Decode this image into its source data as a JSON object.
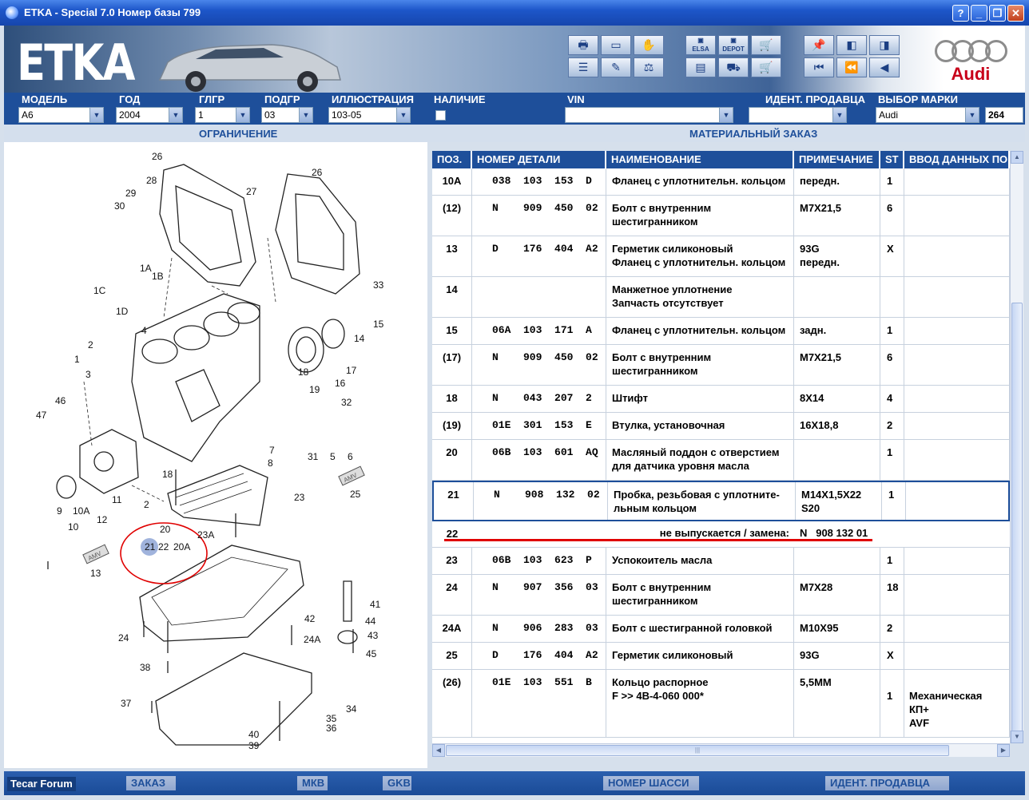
{
  "window": {
    "title": "ETKA - Special 7.0 Номер базы 799"
  },
  "banner": {
    "logo": "ETKA",
    "brand": "Audi"
  },
  "fields": {
    "model_label": "МОДЕЛЬ",
    "model_value": "A6",
    "year_label": "ГОД",
    "year_value": "2004",
    "mgroup_label": "ГЛГР",
    "mgroup_value": "1",
    "sgroup_label": "ПОДГР",
    "sgroup_value": "03",
    "illus_label": "ИЛЛЮСТРАЦИЯ",
    "illus_value": "103-05",
    "avail_label": "НАЛИЧИЕ",
    "vin_label": "VIN",
    "dealer_label": "ИДЕНТ. ПРОДАВЦА",
    "brand_label": "ВЫБОР МАРКИ",
    "brand_value": "Audi",
    "brand_code": "264"
  },
  "strip": {
    "left": "ОГРАНИЧЕНИЕ",
    "right": "МАТЕРИАЛЬНЫЙ ЗАКАЗ"
  },
  "table": {
    "headers": [
      "ПОЗ.",
      "НОМЕР ДЕТАЛИ",
      "НАИМЕНОВАНИЕ",
      "ПРИМЕЧАНИЕ",
      "ST",
      "ВВОД ДАННЫХ ПО"
    ],
    "rows": [
      {
        "pos": "10A",
        "part": "038  103  153  D",
        "name": [
          "Фланец с уплотнительн. кольцом"
        ],
        "note": [
          "передн."
        ],
        "st": "1",
        "inp": []
      },
      {
        "pos": "(12)",
        "part": "N    909  450  02",
        "name": [
          "Болт с внутренним",
          "шестигранником"
        ],
        "note": [
          "M7X21,5"
        ],
        "st": "6",
        "inp": []
      },
      {
        "pos": "13",
        "part": "D    176  404  A2",
        "name": [
          "Герметик силиконовый",
          "Фланец с уплотнительн. кольцом"
        ],
        "note": [
          "93G",
          "передн."
        ],
        "st": "X",
        "inp": []
      },
      {
        "pos": "14",
        "part": "",
        "name": [
          "Манжетное уплотнение",
          "Запчасть отсутствует"
        ],
        "note": [],
        "st": "",
        "inp": []
      },
      {
        "pos": "15",
        "part": "06A  103  171  A",
        "name": [
          "Фланец с уплотнительн. кольцом"
        ],
        "note": [
          "задн."
        ],
        "st": "1",
        "inp": []
      },
      {
        "pos": "(17)",
        "part": "N    909  450  02",
        "name": [
          "Болт с внутренним",
          "шестигранником"
        ],
        "note": [
          "M7X21,5"
        ],
        "st": "6",
        "inp": []
      },
      {
        "pos": "18",
        "part": "N    043  207  2",
        "name": [
          "Штифт"
        ],
        "note": [
          "8X14"
        ],
        "st": "4",
        "inp": []
      },
      {
        "pos": "(19)",
        "part": "01E  301  153  E",
        "name": [
          "Втулка, установочная"
        ],
        "note": [
          "16X18,8"
        ],
        "st": "2",
        "inp": []
      },
      {
        "pos": "20",
        "part": "06B  103  601  AQ",
        "name": [
          "Масляный поддон с отверстием",
          "для датчика уровня масла"
        ],
        "note": [],
        "st": "1",
        "inp": []
      },
      {
        "pos": "21",
        "part": "N    908  132  02",
        "name": [
          "Пробка, резьбовая с уплотните-",
          "льным кольцом"
        ],
        "note": [
          "M14X1,5X22",
          "S20"
        ],
        "st": "1",
        "inp": []
      },
      {
        "pos": "23",
        "part": "06B  103  623  P",
        "name": [
          "Успокоитель масла"
        ],
        "note": [],
        "st": "1",
        "inp": []
      },
      {
        "pos": "24",
        "part": "N    907  356  03",
        "name": [
          "Болт с внутренним",
          "шестигранником"
        ],
        "note": [
          "M7X28"
        ],
        "st": "18",
        "inp": []
      },
      {
        "pos": "24A",
        "part": "N    906  283  03",
        "name": [
          "Болт с шестигранной головкой"
        ],
        "note": [
          "M10X95"
        ],
        "st": "2",
        "inp": []
      },
      {
        "pos": "25",
        "part": "D    176  404  A2",
        "name": [
          "Герметик силиконовый"
        ],
        "note": [
          "93G"
        ],
        "st": "X",
        "inp": []
      },
      {
        "pos": "(26)",
        "part": "01E  103  551  B",
        "name": [
          "Кольцо распорное",
          "F             >> 4B-4-060 000*"
        ],
        "note": [
          "5,5MM"
        ],
        "st": "1",
        "inp": [
          "Механическая",
          "КП+",
          "AVF"
        ]
      }
    ],
    "sub_row": {
      "pos": "22",
      "text": "не выпускается / замена:",
      "part": "N   908 132 01"
    }
  },
  "statusbar": {
    "forum": "Tecar Forum",
    "order": "ЗАКАЗ",
    "mkb": "МКВ",
    "gkb": "GKB",
    "chassis": "НОМЕР ШАССИ",
    "dealer": "ИДЕНТ. ПРОДАВЦА"
  },
  "diagram": {
    "callouts": [
      "1",
      "1A",
      "1B",
      "1C",
      "1D",
      "2",
      "3",
      "4",
      "5",
      "6",
      "7",
      "8",
      "9",
      "10",
      "10A",
      "11",
      "12",
      "13",
      "14",
      "15",
      "16",
      "17",
      "18",
      "19",
      "20",
      "20A",
      "21",
      "22",
      "23",
      "23A",
      "24",
      "24A",
      "25",
      "26",
      "27",
      "28",
      "29",
      "30",
      "31",
      "32",
      "33",
      "34",
      "35",
      "36",
      "37",
      "38",
      "39",
      "40",
      "41",
      "42",
      "43",
      "44",
      "45",
      "46",
      "47"
    ],
    "chip_label": "AMV"
  },
  "colors": {
    "accent": "#1e4f9a",
    "highlight_red": "#e00000",
    "selected_border": "#1e4f9a"
  }
}
